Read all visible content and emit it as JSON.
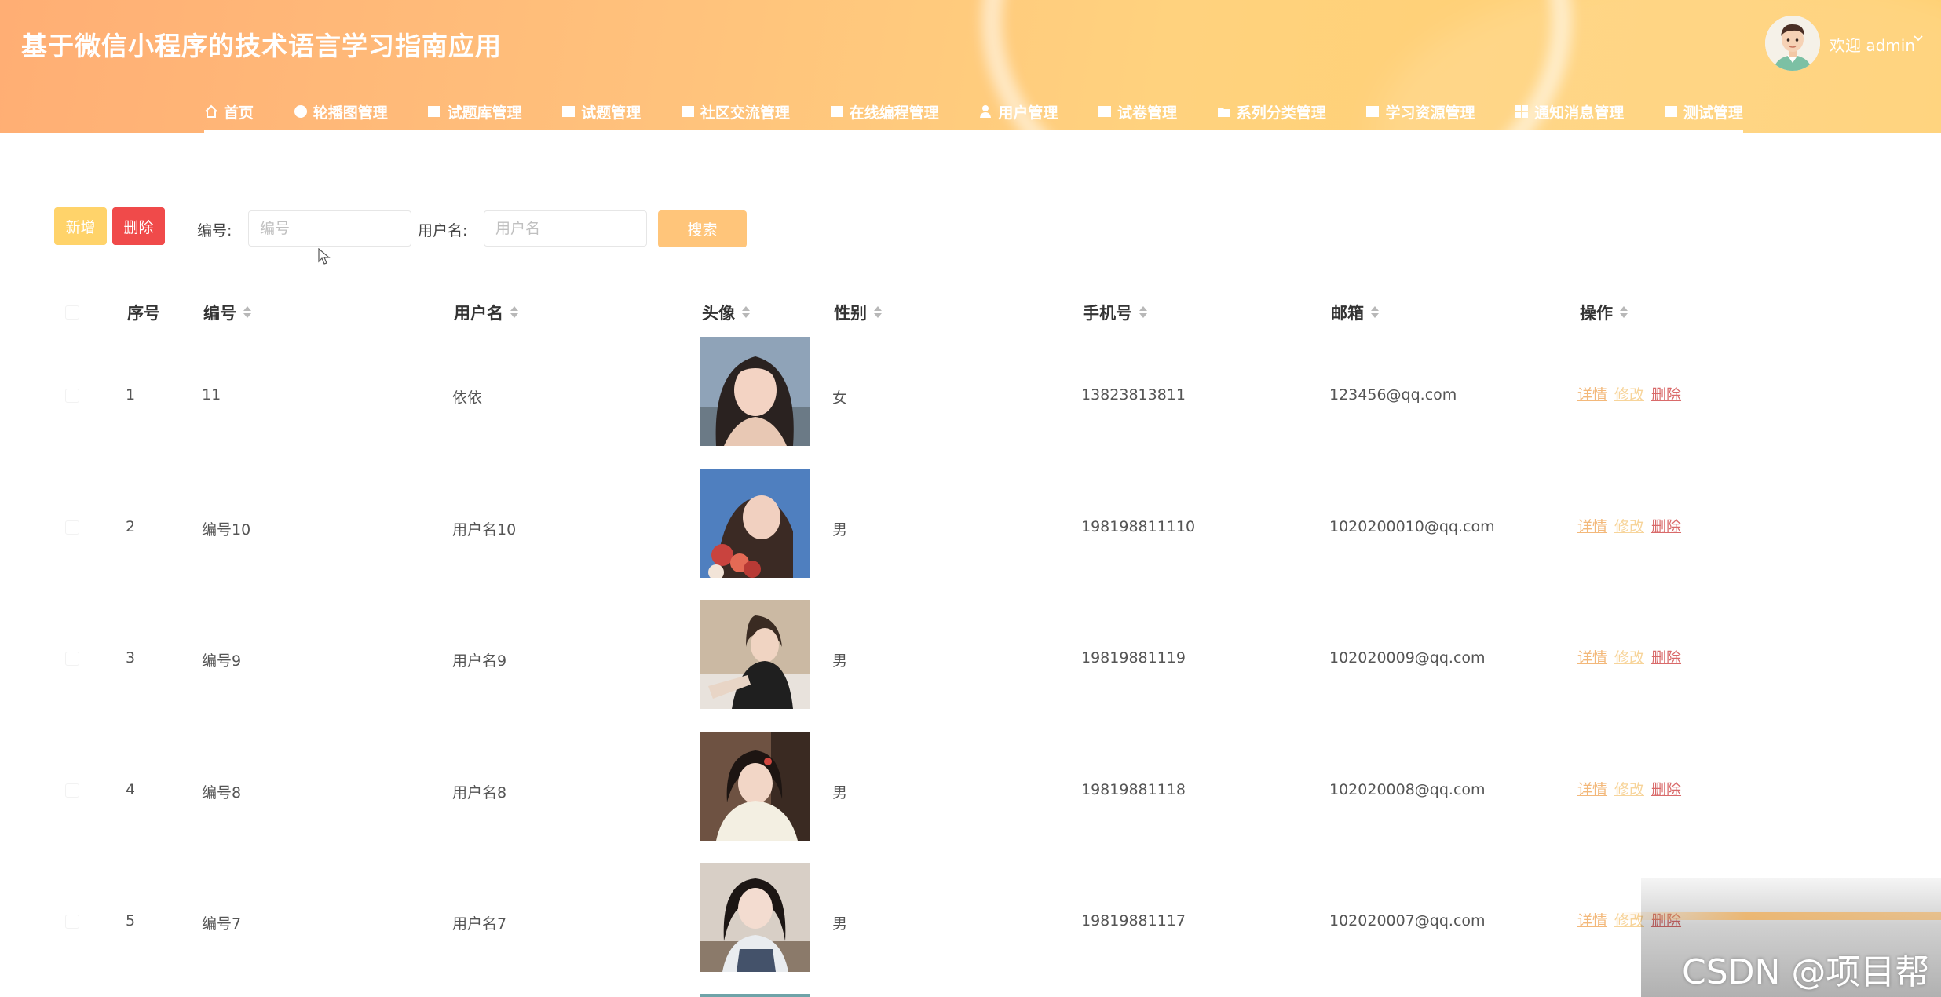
{
  "app": {
    "title": "基于微信小程序的技术语言学习指南应用"
  },
  "user": {
    "welcome": "欢迎 admin"
  },
  "nav": [
    {
      "label": "首页",
      "icon": "home-icon"
    },
    {
      "label": "轮播图管理",
      "icon": "circle-icon"
    },
    {
      "label": "试题库管理",
      "icon": "list-icon"
    },
    {
      "label": "试题管理",
      "icon": "list-icon"
    },
    {
      "label": "社区交流管理",
      "icon": "list-icon"
    },
    {
      "label": "在线编程管理",
      "icon": "list-icon"
    },
    {
      "label": "用户管理",
      "icon": "user-icon"
    },
    {
      "label": "试卷管理",
      "icon": "list-icon"
    },
    {
      "label": "系列分类管理",
      "icon": "folder-icon"
    },
    {
      "label": "学习资源管理",
      "icon": "list-icon"
    },
    {
      "label": "通知消息管理",
      "icon": "grid-icon"
    },
    {
      "label": "测试管理",
      "icon": "list-icon"
    }
  ],
  "toolbar": {
    "add_label": "新增",
    "delete_label": "删除",
    "id_label": "编号:",
    "id_placeholder": "编号",
    "name_label": "用户名:",
    "name_placeholder": "用户名",
    "search_label": "搜索"
  },
  "table": {
    "headers": {
      "index": "序号",
      "id": "编号",
      "username": "用户名",
      "avatar": "头像",
      "gender": "性别",
      "phone": "手机号",
      "email": "邮箱",
      "actions": "操作"
    },
    "actions": {
      "detail": "详情",
      "edit": "修改",
      "delete": "删除"
    },
    "rows": [
      {
        "index": "1",
        "id": "11",
        "username": "依依",
        "gender": "女",
        "phone": "13823813811",
        "email": "123456@qq.com"
      },
      {
        "index": "2",
        "id": "编号10",
        "username": "用户名10",
        "gender": "男",
        "phone": "198198811110",
        "email": "1020200010@qq.com"
      },
      {
        "index": "3",
        "id": "编号9",
        "username": "用户名9",
        "gender": "男",
        "phone": "19819881119",
        "email": "102020009@qq.com"
      },
      {
        "index": "4",
        "id": "编号8",
        "username": "用户名8",
        "gender": "男",
        "phone": "19819881118",
        "email": "102020008@qq.com"
      },
      {
        "index": "5",
        "id": "编号7",
        "username": "用户名7",
        "gender": "男",
        "phone": "19819881117",
        "email": "102020007@qq.com"
      }
    ]
  },
  "watermark": "CSDN @项目帮",
  "colors": {
    "header_start": "#ffae74",
    "header_end": "#ffcf6e",
    "add_button": "#ffd36a",
    "delete_button": "#f04a4a",
    "search_button": "#ffc57a"
  }
}
